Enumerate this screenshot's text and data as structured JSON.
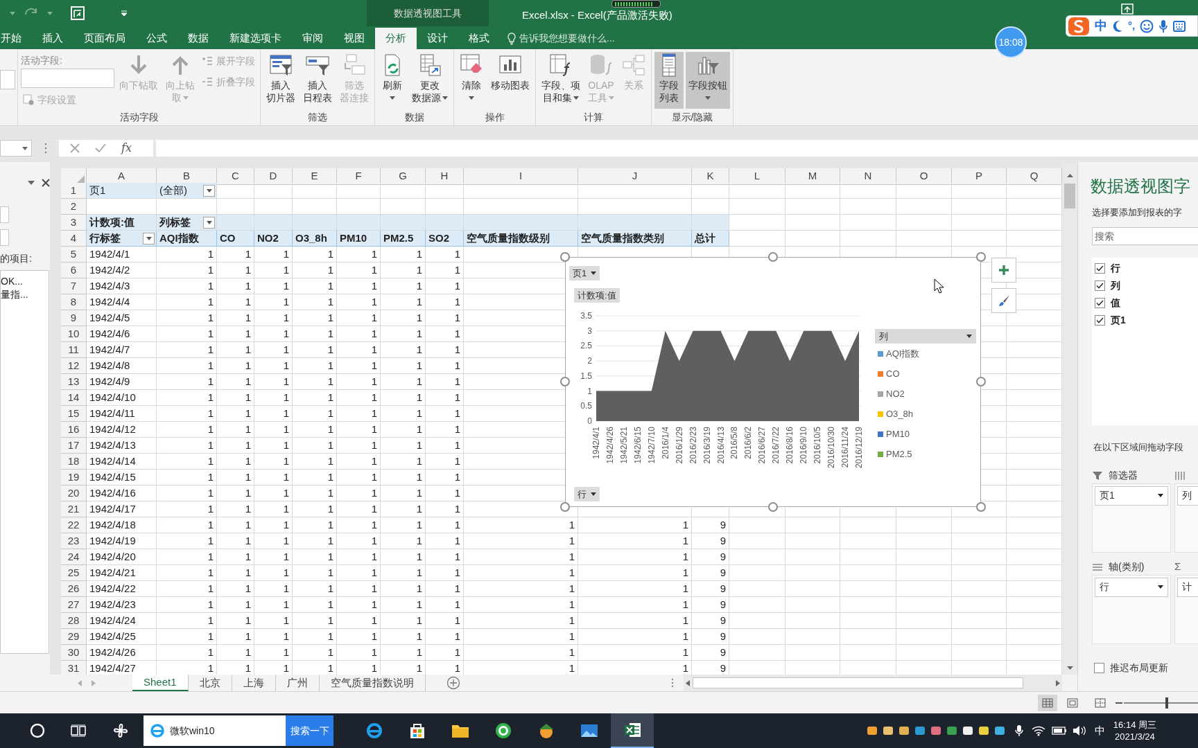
{
  "title_bar": {
    "context_tab": "数据透视图工具",
    "title": "Excel.xlsx - Excel(产品激活失败)"
  },
  "clock_badge": "18:08",
  "ime_toolbar": {
    "mode": "中",
    "punctuation": "°,"
  },
  "ribbon_tabs": [
    {
      "label": "开始",
      "selected": false
    },
    {
      "label": "插入",
      "selected": false
    },
    {
      "label": "页面布局",
      "selected": false
    },
    {
      "label": "公式",
      "selected": false
    },
    {
      "label": "数据",
      "selected": false
    },
    {
      "label": "新建选项卡",
      "selected": false
    },
    {
      "label": "审阅",
      "selected": false
    },
    {
      "label": "视图",
      "selected": false
    },
    {
      "label": "分析",
      "selected": true
    },
    {
      "label": "设计",
      "selected": false
    },
    {
      "label": "格式",
      "selected": false
    }
  ],
  "tell_me": {
    "placeholder": "告诉我您想要做什么..."
  },
  "ribbon_groups": [
    {
      "label": "活动字段",
      "columns": [
        [
          {
            "kind": "field-label",
            "label": "活动字段:"
          },
          {
            "kind": "input"
          },
          {
            "kind": "small",
            "label": "字段设置",
            "disabled": true
          }
        ],
        [
          {
            "kind": "large",
            "lines": [
              "向下钻取"
            ],
            "disabled": true
          }
        ],
        [
          {
            "kind": "large",
            "lines": [
              "向上钻",
              "取"
            ],
            "disabled": true,
            "caret": true
          }
        ],
        [
          {
            "kind": "small",
            "label": "展开字段",
            "disabled": true
          },
          {
            "kind": "small",
            "label": "折叠字段",
            "disabled": true
          }
        ]
      ]
    },
    {
      "label": "筛选",
      "columns": [
        [
          {
            "kind": "large",
            "lines": [
              "插入",
              "切片器"
            ],
            "disabled": false
          }
        ],
        [
          {
            "kind": "large",
            "lines": [
              "插入",
              "日程表"
            ],
            "disabled": false
          }
        ],
        [
          {
            "kind": "large",
            "lines": [
              "筛选",
              "器连接"
            ],
            "disabled": true
          }
        ]
      ]
    },
    {
      "label": "数据",
      "columns": [
        [
          {
            "kind": "large",
            "lines": [
              "刷新"
            ],
            "disabled": false,
            "caret": true
          }
        ],
        [
          {
            "kind": "large",
            "lines": [
              "更改",
              "数据源"
            ],
            "disabled": false,
            "caret": true
          }
        ]
      ]
    },
    {
      "label": "操作",
      "columns": [
        [
          {
            "kind": "large",
            "lines": [
              "清除"
            ],
            "disabled": false,
            "caret": true
          }
        ],
        [
          {
            "kind": "large",
            "lines": [
              "移动图表"
            ],
            "disabled": false
          }
        ]
      ]
    },
    {
      "label": "计算",
      "columns": [
        [
          {
            "kind": "large",
            "lines": [
              "字段、项",
              "目和集"
            ],
            "disabled": false,
            "caret": true
          }
        ],
        [
          {
            "kind": "large",
            "lines": [
              "OLAP",
              "工具"
            ],
            "disabled": true,
            "caret": true
          }
        ],
        [
          {
            "kind": "large",
            "lines": [
              "关系"
            ],
            "disabled": true
          }
        ]
      ]
    },
    {
      "label": "显示/隐藏",
      "columns": [
        [
          {
            "kind": "large",
            "lines": [
              "字段",
              "列表"
            ],
            "disabled": false,
            "pressed": true
          }
        ],
        [
          {
            "kind": "large",
            "lines": [
              "字段按钮"
            ],
            "disabled": false,
            "pressed": true,
            "caret": true
          }
        ]
      ]
    }
  ],
  "formula_bar": {
    "function_symbol": "fx"
  },
  "left_pane": {
    "label": "的项目:",
    "items": [
      "OK...",
      "量指..."
    ]
  },
  "sheet": {
    "columns": [
      "A",
      "B",
      "C",
      "D",
      "E",
      "F",
      "G",
      "H",
      "I",
      "J",
      "K",
      "L",
      "M",
      "N",
      "O",
      "P",
      "Q"
    ],
    "row_numbers": [
      "1",
      "2",
      "3",
      "4",
      "5",
      "6",
      "7",
      "8",
      "9",
      "10",
      "11",
      "12",
      "13",
      "14",
      "15",
      "16",
      "17",
      "18",
      "19",
      "20",
      "21",
      "22",
      "23",
      "24",
      "25",
      "26",
      "27",
      "28",
      "29",
      "30",
      "31"
    ]
  },
  "pivot": {
    "filter": {
      "field": "页1",
      "value": "(全部)"
    },
    "values_label": "计数项:值",
    "column_labels": "列标签",
    "row_labels": "行标签",
    "headers": [
      "AQI指数",
      "CO",
      "NO2",
      "O3_8h",
      "PM10",
      "PM2.5",
      "SO2",
      "空气质量指数级别",
      "空气质量指数类别",
      "总计"
    ],
    "rows": [
      {
        "label": "1942/4/1",
        "values": [
          "1",
          "1",
          "1",
          "1",
          "1",
          "1",
          "1"
        ]
      },
      {
        "label": "1942/4/2",
        "values": [
          "1",
          "1",
          "1",
          "1",
          "1",
          "1",
          "1"
        ]
      },
      {
        "label": "1942/4/3",
        "values": [
          "1",
          "1",
          "1",
          "1",
          "1",
          "1",
          "1"
        ]
      },
      {
        "label": "1942/4/4",
        "values": [
          "1",
          "1",
          "1",
          "1",
          "1",
          "1",
          "1"
        ]
      },
      {
        "label": "1942/4/5",
        "values": [
          "1",
          "1",
          "1",
          "1",
          "1",
          "1",
          "1"
        ]
      },
      {
        "label": "1942/4/6",
        "values": [
          "1",
          "1",
          "1",
          "1",
          "1",
          "1",
          "1"
        ]
      },
      {
        "label": "1942/4/7",
        "values": [
          "1",
          "1",
          "1",
          "1",
          "1",
          "1",
          "1"
        ]
      },
      {
        "label": "1942/4/8",
        "values": [
          "1",
          "1",
          "1",
          "1",
          "1",
          "1",
          "1"
        ]
      },
      {
        "label": "1942/4/9",
        "values": [
          "1",
          "1",
          "1",
          "1",
          "1",
          "1",
          "1"
        ]
      },
      {
        "label": "1942/4/10",
        "values": [
          "1",
          "1",
          "1",
          "1",
          "1",
          "1",
          "1"
        ]
      },
      {
        "label": "1942/4/11",
        "values": [
          "1",
          "1",
          "1",
          "1",
          "1",
          "1",
          "1"
        ]
      },
      {
        "label": "1942/4/12",
        "values": [
          "1",
          "1",
          "1",
          "1",
          "1",
          "1",
          "1"
        ]
      },
      {
        "label": "1942/4/13",
        "values": [
          "1",
          "1",
          "1",
          "1",
          "1",
          "1",
          "1"
        ]
      },
      {
        "label": "1942/4/14",
        "values": [
          "1",
          "1",
          "1",
          "1",
          "1",
          "1",
          "1"
        ]
      },
      {
        "label": "1942/4/15",
        "values": [
          "1",
          "1",
          "1",
          "1",
          "1",
          "1",
          "1"
        ]
      },
      {
        "label": "1942/4/16",
        "values": [
          "1",
          "1",
          "1",
          "1",
          "1",
          "1",
          "1"
        ]
      },
      {
        "label": "1942/4/17",
        "values": [
          "1",
          "1",
          "1",
          "1",
          "1",
          "1",
          "1"
        ]
      },
      {
        "label": "1942/4/18",
        "values": [
          "1",
          "1",
          "1",
          "1",
          "1",
          "1",
          "1"
        ],
        "extra": [
          "1",
          "1",
          "9"
        ]
      },
      {
        "label": "1942/4/19",
        "values": [
          "1",
          "1",
          "1",
          "1",
          "1",
          "1",
          "1"
        ],
        "extra": [
          "1",
          "1",
          "9"
        ]
      },
      {
        "label": "1942/4/20",
        "values": [
          "1",
          "1",
          "1",
          "1",
          "1",
          "1",
          "1"
        ],
        "extra": [
          "1",
          "1",
          "9"
        ]
      },
      {
        "label": "1942/4/21",
        "values": [
          "1",
          "1",
          "1",
          "1",
          "1",
          "1",
          "1"
        ],
        "extra": [
          "1",
          "1",
          "9"
        ]
      },
      {
        "label": "1942/4/22",
        "values": [
          "1",
          "1",
          "1",
          "1",
          "1",
          "1",
          "1"
        ],
        "extra": [
          "1",
          "1",
          "9"
        ]
      },
      {
        "label": "1942/4/23",
        "values": [
          "1",
          "1",
          "1",
          "1",
          "1",
          "1",
          "1"
        ],
        "extra": [
          "1",
          "1",
          "9"
        ]
      },
      {
        "label": "1942/4/24",
        "values": [
          "1",
          "1",
          "1",
          "1",
          "1",
          "1",
          "1"
        ],
        "extra": [
          "1",
          "1",
          "9"
        ]
      },
      {
        "label": "1942/4/25",
        "values": [
          "1",
          "1",
          "1",
          "1",
          "1",
          "1",
          "1"
        ],
        "extra": [
          "1",
          "1",
          "9"
        ]
      },
      {
        "label": "1942/4/26",
        "values": [
          "1",
          "1",
          "1",
          "1",
          "1",
          "1",
          "1"
        ],
        "extra": [
          "1",
          "1",
          "9"
        ]
      },
      {
        "label": "1942/4/27",
        "values": [
          "1",
          "1",
          "1",
          "1",
          "1",
          "1",
          "1"
        ],
        "extra": [
          "1",
          "1",
          "9"
        ]
      }
    ]
  },
  "chart": {
    "page_button": "页1",
    "values_button": "计数项:值",
    "axis_button": "行",
    "legend": {
      "field": "列",
      "items": [
        {
          "label": "AQI指数",
          "color": "#5b9bd5"
        },
        {
          "label": "CO",
          "color": "#ed7d31"
        },
        {
          "label": "NO2",
          "color": "#a5a5a5"
        },
        {
          "label": "O3_8h",
          "color": "#ffc000"
        },
        {
          "label": "PM10",
          "color": "#4472c4"
        },
        {
          "label": "PM2.5",
          "color": "#70ad47"
        }
      ]
    },
    "chart_data": {
      "type": "area",
      "categories": [
        "1942/4/1",
        "1942/4/26",
        "1942/5/21",
        "1942/6/15",
        "1942/7/10",
        "2016/1/4",
        "2016/1/29",
        "2016/2/23",
        "2016/3/19",
        "2016/4/13",
        "2016/5/8",
        "2016/6/2",
        "2016/6/27",
        "2016/7/22",
        "2016/8/16",
        "2016/9/10",
        "2016/10/5",
        "2016/10/30",
        "2016/11/24",
        "2016/12/19"
      ],
      "series": [
        {
          "color": "#5f5f5f",
          "values": [
            1,
            1,
            1,
            1,
            1,
            3,
            2,
            3,
            3,
            3,
            2,
            3,
            3,
            3,
            2,
            3,
            3,
            3,
            2,
            3
          ]
        }
      ],
      "ylim": [
        0,
        3.5
      ],
      "yticks": [
        0,
        0.5,
        1,
        1.5,
        2,
        2.5,
        3,
        3.5
      ],
      "grid": true
    }
  },
  "sheet_tabs": [
    {
      "label": "Sheet1",
      "selected": true
    },
    {
      "label": "北京",
      "selected": false
    },
    {
      "label": "上海",
      "selected": false
    },
    {
      "label": "广州",
      "selected": false
    },
    {
      "label": "空气质量指数说明",
      "selected": false
    }
  ],
  "field_pane": {
    "title": "数据透视图字",
    "subtitle": "选择要添加到报表的字",
    "search": {
      "placeholder": "搜索"
    },
    "fields": [
      {
        "label": "行",
        "checked": true
      },
      {
        "label": "列",
        "checked": true
      },
      {
        "label": "值",
        "checked": true
      },
      {
        "label": "页1",
        "checked": true
      }
    ],
    "drag_hint": "在以下区域间拖动字段",
    "areas": [
      {
        "kind": "filter",
        "label": "筛选器",
        "items": [
          "页1"
        ]
      },
      {
        "kind": "legend",
        "items": [
          "列"
        ]
      },
      {
        "kind": "axis",
        "label": "轴(类别)",
        "items": [
          "行"
        ]
      },
      {
        "kind": "values",
        "symbol": "Σ",
        "items": [
          "计"
        ]
      }
    ],
    "defer_update": {
      "label": "推迟布局更新",
      "checked": false
    }
  },
  "status_bar": {
    "zoom_slider": {
      "level": 0.56
    }
  },
  "taskbar": {
    "search": {
      "value": "微软win10",
      "button": "搜索一下"
    },
    "apps": [
      {
        "kind": "ie",
        "selected": false
      },
      {
        "kind": "store",
        "selected": false
      },
      {
        "kind": "folder",
        "selected": false
      },
      {
        "kind": "browser",
        "selected": false
      },
      {
        "kind": "game",
        "selected": false
      },
      {
        "kind": "photos",
        "selected": false
      },
      {
        "kind": "excel",
        "selected": true
      }
    ],
    "ime": "中",
    "time": "16:14 周三",
    "date": "2021/3/24"
  }
}
